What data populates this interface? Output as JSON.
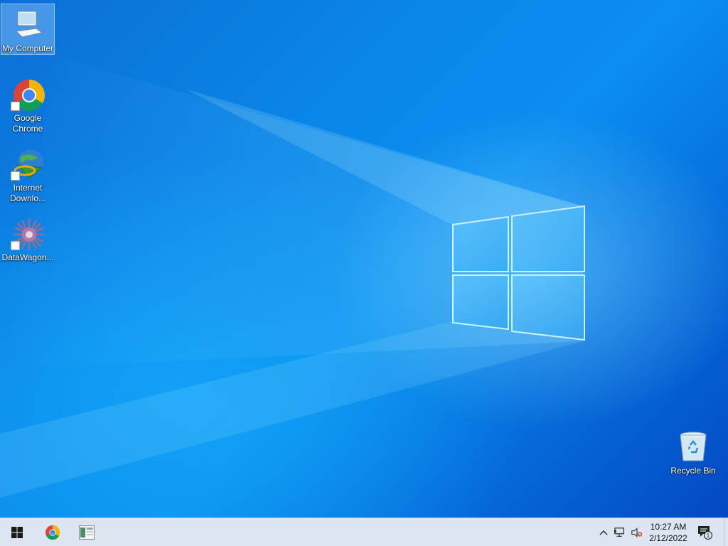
{
  "desktop": {
    "icons": [
      {
        "label": "My Computer",
        "icon": "computer-icon",
        "selected": true
      },
      {
        "label": "Google\nChrome",
        "icon": "chrome-icon"
      },
      {
        "label": "Internet\nDownlo...",
        "icon": "idm-globe-icon"
      },
      {
        "label": "DataWagon...",
        "icon": "datawagon-icon"
      },
      {
        "label": "Recycle Bin",
        "icon": "recycle-bin-icon"
      }
    ]
  },
  "taskbar": {
    "start": {
      "icon": "windows-logo-icon"
    },
    "pinned": [
      {
        "icon": "chrome-icon"
      },
      {
        "icon": "app-window-icon"
      }
    ],
    "tray": {
      "icons": [
        "chevron-up-icon",
        "network-icon",
        "volume-muted-icon"
      ],
      "time": "10:27 AM",
      "date": "2/12/2022",
      "notification_count": "1"
    }
  },
  "colors": {
    "accent": "#0a78e0",
    "taskbar": "#dde6f0"
  }
}
